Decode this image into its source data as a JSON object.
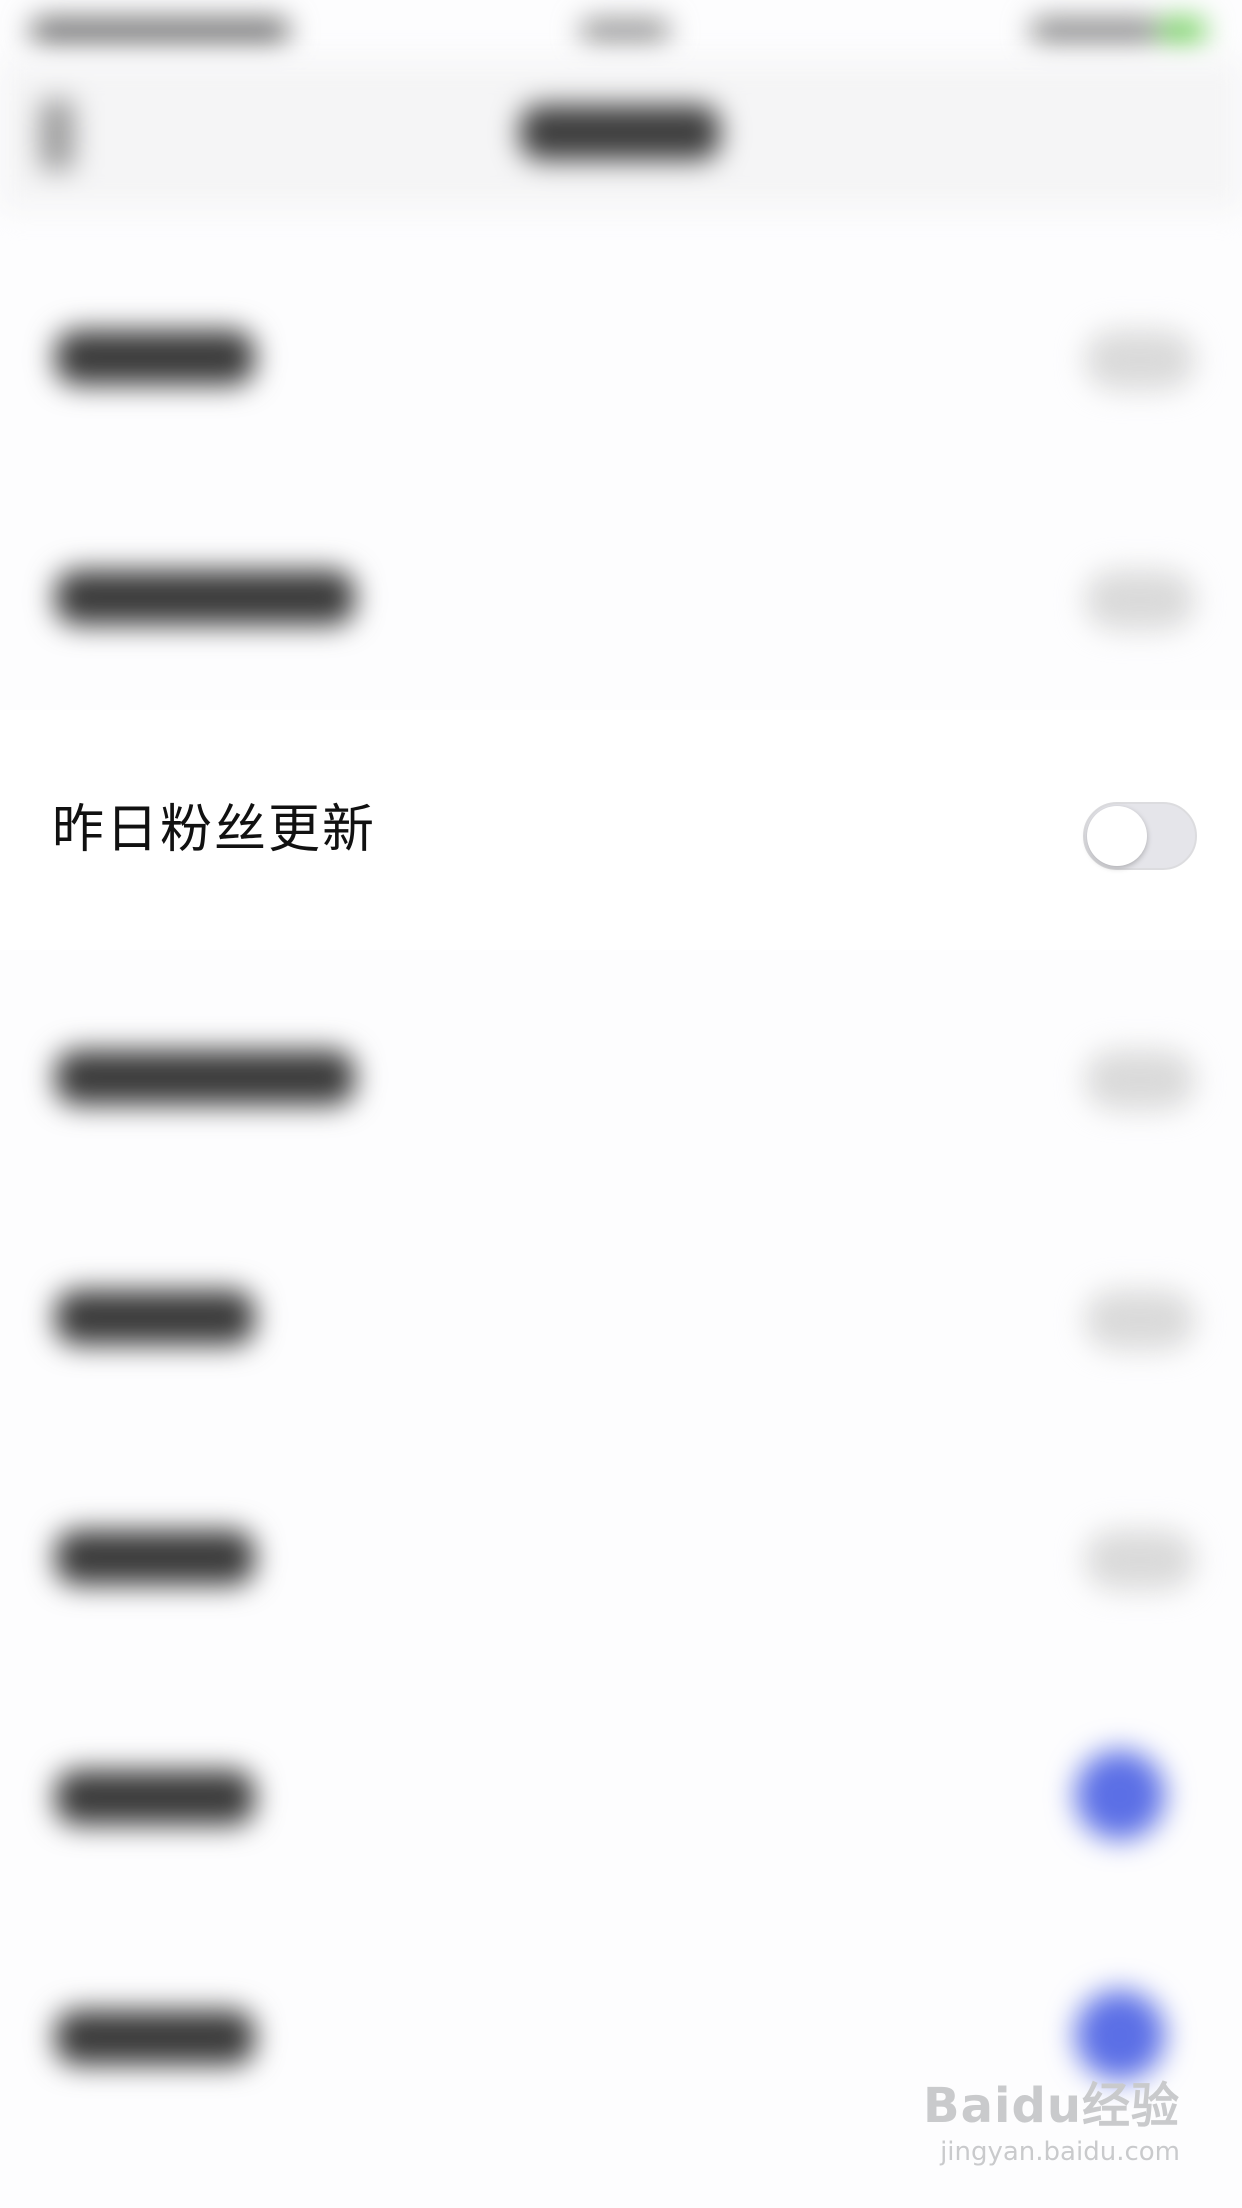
{
  "setting_row": {
    "label": "昨日粉丝更新",
    "toggle_state": "off"
  },
  "watermark": {
    "logo_text": "Baidu经验",
    "url_text": "jingyan.baidu.com"
  },
  "colors": {
    "toggle_off_track": "#e5e5ea",
    "toggle_knob": "#ffffff",
    "accent_blue": "#5b6fe6",
    "status_battery": "#6fcf5a"
  }
}
